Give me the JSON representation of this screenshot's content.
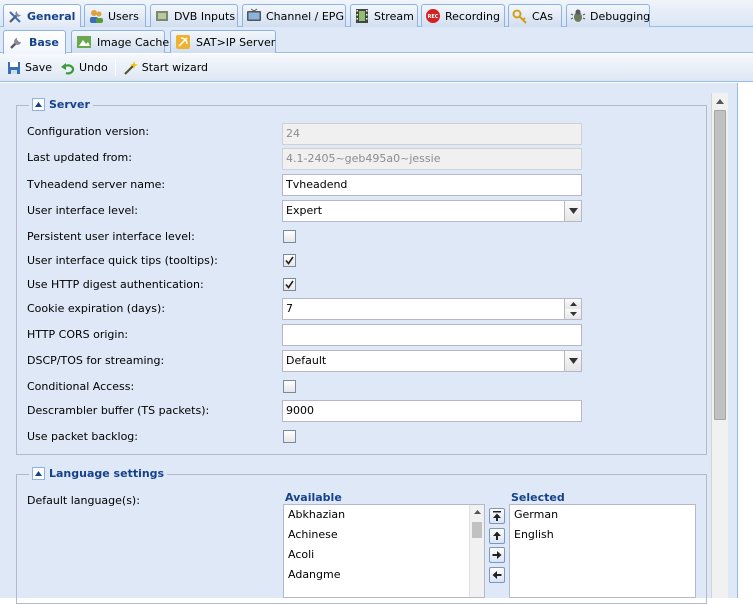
{
  "tabs": [
    {
      "label": "General",
      "icon": "wrench-screwdriver-icon",
      "active": true
    },
    {
      "label": "Users",
      "icon": "users-icon"
    },
    {
      "label": "DVB Inputs",
      "icon": "dvb-input-icon"
    },
    {
      "label": "Channel / EPG",
      "icon": "tv-icon"
    },
    {
      "label": "Stream",
      "icon": "film-icon"
    },
    {
      "label": "Recording",
      "icon": "rec-icon"
    },
    {
      "label": "CAs",
      "icon": "key-icon"
    },
    {
      "label": "Debugging",
      "icon": "bug-icon"
    }
  ],
  "subtabs": [
    {
      "label": "Base",
      "icon": "wrench-icon",
      "active": true
    },
    {
      "label": "Image Cache",
      "icon": "image-icon"
    },
    {
      "label": "SAT>IP Server",
      "icon": "satip-icon"
    }
  ],
  "toolbar": {
    "save": "Save",
    "undo": "Undo",
    "wizard": "Start wizard"
  },
  "server": {
    "title": "Server",
    "config_version_label": "Configuration version:",
    "config_version": "24",
    "last_updated_label": "Last updated from:",
    "last_updated": "4.1-2405~geb495a0~jessie",
    "server_name_label": "Tvheadend server name:",
    "server_name": "Tvheadend",
    "ui_level_label": "User interface level:",
    "ui_level": "Expert",
    "persistent_ui_label": "Persistent user interface level:",
    "persistent_ui": false,
    "tooltips_label": "User interface quick tips (tooltips):",
    "tooltips": true,
    "digest_label": "Use HTTP digest authentication:",
    "digest": true,
    "cookie_label": "Cookie expiration (days):",
    "cookie": "7",
    "cors_label": "HTTP CORS origin:",
    "cors": "",
    "dscp_label": "DSCP/TOS for streaming:",
    "dscp": "Default",
    "ca_label": "Conditional Access:",
    "ca": false,
    "descrambler_label": "Descrambler buffer (TS packets):",
    "descrambler": "9000",
    "backlog_label": "Use packet backlog:",
    "backlog": false
  },
  "language": {
    "title": "Language settings",
    "default_label": "Default language(s):",
    "available_header": "Available",
    "selected_header": "Selected",
    "available": [
      "Abkhazian",
      "Achinese",
      "Acoli",
      "Adangme"
    ],
    "selected": [
      "German",
      "English"
    ]
  },
  "colors": {
    "accent": "#15428b",
    "panel": "#dfe8f6",
    "border": "#99bbe8"
  }
}
